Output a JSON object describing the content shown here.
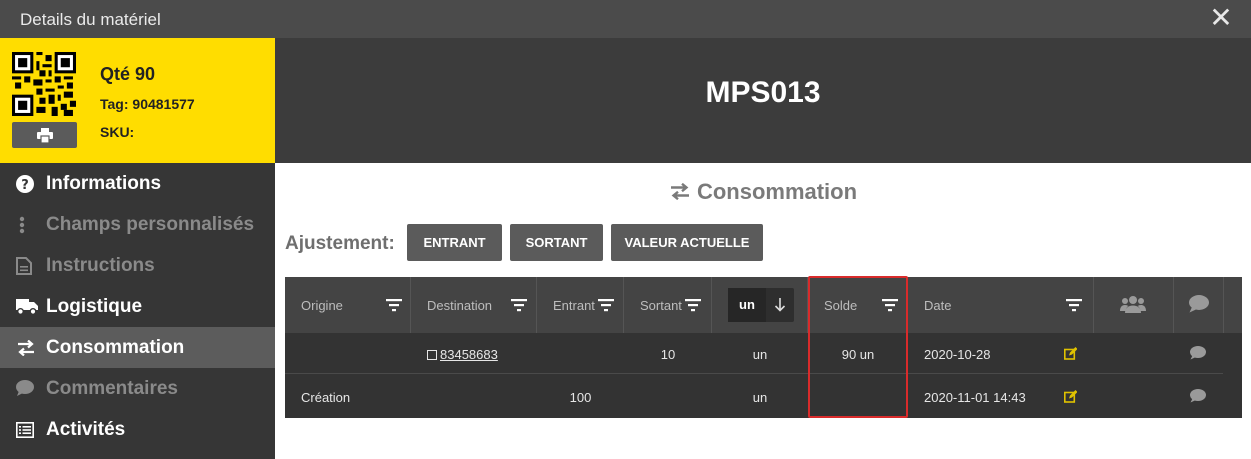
{
  "window": {
    "title": "Details du matériel",
    "close_icon": "close-icon"
  },
  "card": {
    "qty": "Qté 90",
    "tag": "Tag: 90481577",
    "sku": "SKU:",
    "bg_color": "#ffdd00"
  },
  "nav": [
    {
      "label": "Informations",
      "icon": "question-circle-icon",
      "state": "enabled"
    },
    {
      "label": "Champs personnalisés",
      "icon": "vertical-dots-icon",
      "state": "disabled"
    },
    {
      "label": "Instructions",
      "icon": "document-icon",
      "state": "disabled"
    },
    {
      "label": "Logistique",
      "icon": "truck-icon",
      "state": "enabled"
    },
    {
      "label": "Consommation",
      "icon": "swap-arrows-icon",
      "state": "active"
    },
    {
      "label": "Commentaires",
      "icon": "comment-icon",
      "state": "disabled"
    },
    {
      "label": "Activités",
      "icon": "list-icon",
      "state": "enabled"
    }
  ],
  "header": {
    "code": "MPS013"
  },
  "section": {
    "title": "Consommation",
    "icon": "swap-arrows-icon"
  },
  "adjust": {
    "label": "Ajustement:",
    "buttons": [
      "ENTRANT",
      "SORTANT",
      "VALEUR ACTUELLE"
    ]
  },
  "table": {
    "headers": {
      "origine": "Origine",
      "destination": "Destination",
      "entrant": "Entrant",
      "sortant": "Sortant",
      "unit_select": "un",
      "sort_icon": "arrow-down-icon",
      "solde": "Solde",
      "date": "Date",
      "users_icon": "users-icon",
      "comments_icon": "comment-icon"
    },
    "rows": [
      {
        "origine": "",
        "destination": "83458683",
        "entrant": "",
        "sortant": "10",
        "unit": "un",
        "solde": "90 un",
        "date": "2020-10-28"
      },
      {
        "origine": "Création",
        "destination": "",
        "entrant": "100",
        "sortant": "",
        "unit": "un",
        "solde": "",
        "date": "2020-11-01 14:43"
      }
    ]
  },
  "colors": {
    "accent": "#ffdd00",
    "highlight": "#d92b2b",
    "dark": "#333333"
  }
}
